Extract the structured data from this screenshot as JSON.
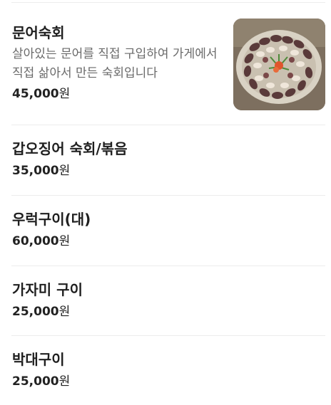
{
  "menu": {
    "items": [
      {
        "name": "문어숙회",
        "description": "살아있는 문어를 직접 구입하여 가게에서 직접 삶아서 만든 숙회입니다",
        "price": "45,000",
        "currency": "원",
        "image": "boiled-octopus-photo"
      },
      {
        "name": "갑오징어 숙회/볶음",
        "price": "35,000",
        "currency": "원"
      },
      {
        "name": "우럭구이(대)",
        "price": "60,000",
        "currency": "원"
      },
      {
        "name": "가자미 구이",
        "price": "25,000",
        "currency": "원"
      },
      {
        "name": "박대구이",
        "price": "25,000",
        "currency": "원"
      }
    ]
  }
}
